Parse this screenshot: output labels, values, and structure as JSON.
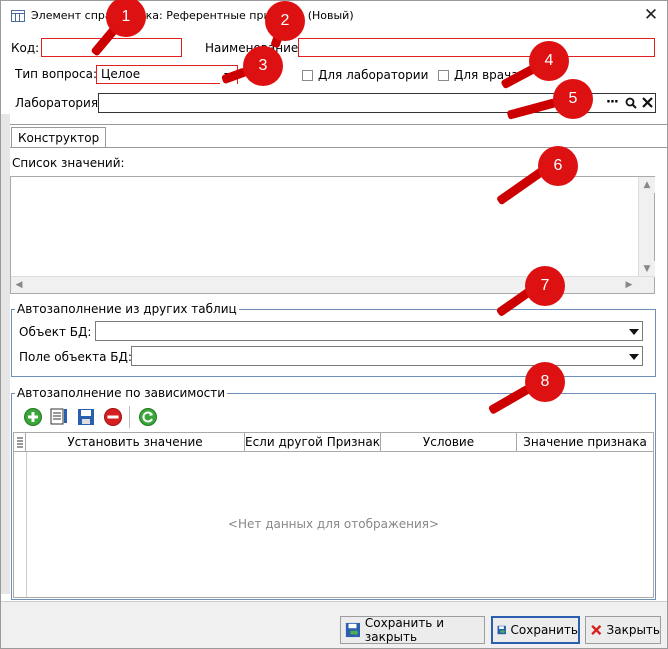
{
  "window": {
    "title": "Элемент справочника: Референтные признаки (Новый)",
    "close_glyph": "✕"
  },
  "form": {
    "code_label": "Код:",
    "code_value": "",
    "name_label": "Наименование:",
    "name_value": "",
    "question_type_label": "Тип вопроса:",
    "question_type_value": "Целое",
    "for_lab_label": "Для лаборатории",
    "for_lab_checked": false,
    "for_doctor_label": "Для врача",
    "for_doctor_checked": false,
    "lab_label": "Лаборатория:",
    "lab_value": "",
    "lab_buttons": [
      "···",
      "search-icon",
      "clear-icon"
    ]
  },
  "tabs": [
    {
      "label": "Конструктор",
      "active": true
    }
  ],
  "constructor": {
    "values_list_label": "Список значений:",
    "values": []
  },
  "autofill_tables": {
    "title": "Автозаполнение из других таблиц",
    "db_object_label": "Объект БД:",
    "db_object_value": "",
    "db_field_label": "Поле объекта БД:",
    "db_field_value": ""
  },
  "autofill_dependency": {
    "title": "Автозаполнение по зависимости",
    "toolbar": [
      "add-icon",
      "edit-icon",
      "save-icon",
      "delete-icon",
      "refresh-icon"
    ],
    "columns": [
      "Установить значение",
      "Если другой Признак",
      "Условие",
      "Значение признака"
    ],
    "rows": [],
    "empty_text": "<Нет данных для отображения>"
  },
  "footer": {
    "save_close_label": "Сохранить и закрыть",
    "save_label": "Сохранить",
    "close_label": "Закрыть"
  },
  "callouts": [
    "1",
    "2",
    "3",
    "4",
    "5",
    "6",
    "7",
    "8"
  ],
  "colors": {
    "callout": "#dd1111",
    "required_border": "#e02020",
    "group_border": "#6d8fb8",
    "focus_border": "#2a5fb0"
  }
}
